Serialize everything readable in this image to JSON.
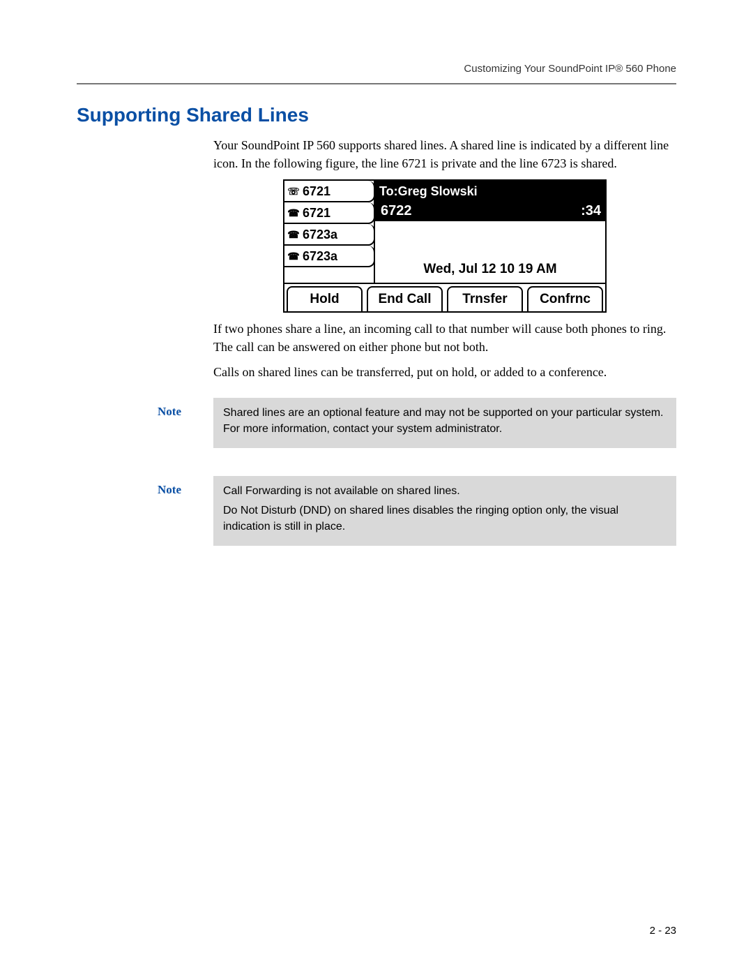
{
  "header": {
    "running": "Customizing Your SoundPoint IP® 560 Phone"
  },
  "section": {
    "title": "Supporting Shared Lines"
  },
  "paragraphs": {
    "p1": "Your SoundPoint IP 560 supports shared lines. A shared line is indicated by a different line icon. In the following figure, the line 6721 is private and the line 6723 is shared.",
    "p2": "If two phones share a line, an incoming call to that number will cause both phones to ring. The call can be answered on either phone but not both.",
    "p3": "Calls on shared lines can be transferred, put on hold, or added to a conference."
  },
  "phone": {
    "lines": [
      {
        "icon": "shared-line-icon",
        "glyph": "☏",
        "label": "6721"
      },
      {
        "icon": "phone-icon",
        "glyph": "☎",
        "label": "6721"
      },
      {
        "icon": "phone-icon",
        "glyph": "☎",
        "label": "6723a"
      },
      {
        "icon": "phone-icon",
        "glyph": "☎",
        "label": "6723a"
      }
    ],
    "to_label": "To:Greg Slowski",
    "number": "6722",
    "timer": ":34",
    "datetime": "Wed, Jul 12  10 19 AM",
    "softkeys": [
      "Hold",
      "End Call",
      "Trnsfer",
      "Confrnc"
    ]
  },
  "notes": [
    {
      "label": "Note",
      "text1": "Shared lines are an optional feature and may not be supported on your particular system. For more information, contact your system administrator.",
      "text2": ""
    },
    {
      "label": "Note",
      "text1": "Call Forwarding is not available on shared lines.",
      "text2": "Do Not Disturb (DND) on shared lines disables the ringing option only, the visual indication is still in place."
    }
  ],
  "footer": {
    "page": "2 - 23"
  }
}
